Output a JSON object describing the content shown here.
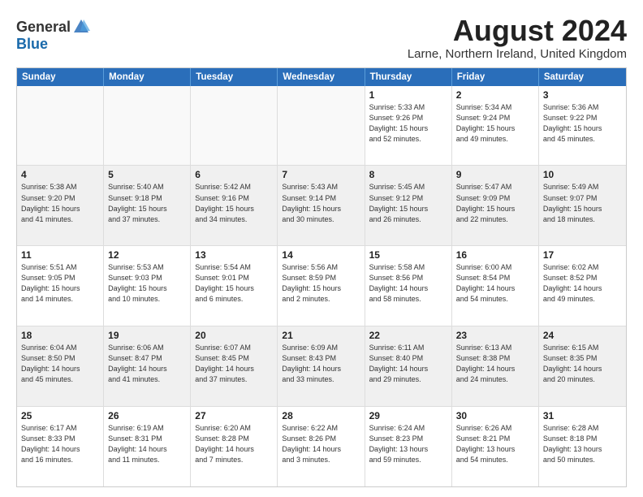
{
  "logo": {
    "general": "General",
    "blue": "Blue"
  },
  "header": {
    "month": "August 2024",
    "location": "Larne, Northern Ireland, United Kingdom"
  },
  "weekdays": [
    "Sunday",
    "Monday",
    "Tuesday",
    "Wednesday",
    "Thursday",
    "Friday",
    "Saturday"
  ],
  "rows": [
    [
      {
        "day": "",
        "info": ""
      },
      {
        "day": "",
        "info": ""
      },
      {
        "day": "",
        "info": ""
      },
      {
        "day": "",
        "info": ""
      },
      {
        "day": "1",
        "info": "Sunrise: 5:33 AM\nSunset: 9:26 PM\nDaylight: 15 hours\nand 52 minutes."
      },
      {
        "day": "2",
        "info": "Sunrise: 5:34 AM\nSunset: 9:24 PM\nDaylight: 15 hours\nand 49 minutes."
      },
      {
        "day": "3",
        "info": "Sunrise: 5:36 AM\nSunset: 9:22 PM\nDaylight: 15 hours\nand 45 minutes."
      }
    ],
    [
      {
        "day": "4",
        "info": "Sunrise: 5:38 AM\nSunset: 9:20 PM\nDaylight: 15 hours\nand 41 minutes."
      },
      {
        "day": "5",
        "info": "Sunrise: 5:40 AM\nSunset: 9:18 PM\nDaylight: 15 hours\nand 37 minutes."
      },
      {
        "day": "6",
        "info": "Sunrise: 5:42 AM\nSunset: 9:16 PM\nDaylight: 15 hours\nand 34 minutes."
      },
      {
        "day": "7",
        "info": "Sunrise: 5:43 AM\nSunset: 9:14 PM\nDaylight: 15 hours\nand 30 minutes."
      },
      {
        "day": "8",
        "info": "Sunrise: 5:45 AM\nSunset: 9:12 PM\nDaylight: 15 hours\nand 26 minutes."
      },
      {
        "day": "9",
        "info": "Sunrise: 5:47 AM\nSunset: 9:09 PM\nDaylight: 15 hours\nand 22 minutes."
      },
      {
        "day": "10",
        "info": "Sunrise: 5:49 AM\nSunset: 9:07 PM\nDaylight: 15 hours\nand 18 minutes."
      }
    ],
    [
      {
        "day": "11",
        "info": "Sunrise: 5:51 AM\nSunset: 9:05 PM\nDaylight: 15 hours\nand 14 minutes."
      },
      {
        "day": "12",
        "info": "Sunrise: 5:53 AM\nSunset: 9:03 PM\nDaylight: 15 hours\nand 10 minutes."
      },
      {
        "day": "13",
        "info": "Sunrise: 5:54 AM\nSunset: 9:01 PM\nDaylight: 15 hours\nand 6 minutes."
      },
      {
        "day": "14",
        "info": "Sunrise: 5:56 AM\nSunset: 8:59 PM\nDaylight: 15 hours\nand 2 minutes."
      },
      {
        "day": "15",
        "info": "Sunrise: 5:58 AM\nSunset: 8:56 PM\nDaylight: 14 hours\nand 58 minutes."
      },
      {
        "day": "16",
        "info": "Sunrise: 6:00 AM\nSunset: 8:54 PM\nDaylight: 14 hours\nand 54 minutes."
      },
      {
        "day": "17",
        "info": "Sunrise: 6:02 AM\nSunset: 8:52 PM\nDaylight: 14 hours\nand 49 minutes."
      }
    ],
    [
      {
        "day": "18",
        "info": "Sunrise: 6:04 AM\nSunset: 8:50 PM\nDaylight: 14 hours\nand 45 minutes."
      },
      {
        "day": "19",
        "info": "Sunrise: 6:06 AM\nSunset: 8:47 PM\nDaylight: 14 hours\nand 41 minutes."
      },
      {
        "day": "20",
        "info": "Sunrise: 6:07 AM\nSunset: 8:45 PM\nDaylight: 14 hours\nand 37 minutes."
      },
      {
        "day": "21",
        "info": "Sunrise: 6:09 AM\nSunset: 8:43 PM\nDaylight: 14 hours\nand 33 minutes."
      },
      {
        "day": "22",
        "info": "Sunrise: 6:11 AM\nSunset: 8:40 PM\nDaylight: 14 hours\nand 29 minutes."
      },
      {
        "day": "23",
        "info": "Sunrise: 6:13 AM\nSunset: 8:38 PM\nDaylight: 14 hours\nand 24 minutes."
      },
      {
        "day": "24",
        "info": "Sunrise: 6:15 AM\nSunset: 8:35 PM\nDaylight: 14 hours\nand 20 minutes."
      }
    ],
    [
      {
        "day": "25",
        "info": "Sunrise: 6:17 AM\nSunset: 8:33 PM\nDaylight: 14 hours\nand 16 minutes."
      },
      {
        "day": "26",
        "info": "Sunrise: 6:19 AM\nSunset: 8:31 PM\nDaylight: 14 hours\nand 11 minutes."
      },
      {
        "day": "27",
        "info": "Sunrise: 6:20 AM\nSunset: 8:28 PM\nDaylight: 14 hours\nand 7 minutes."
      },
      {
        "day": "28",
        "info": "Sunrise: 6:22 AM\nSunset: 8:26 PM\nDaylight: 14 hours\nand 3 minutes."
      },
      {
        "day": "29",
        "info": "Sunrise: 6:24 AM\nSunset: 8:23 PM\nDaylight: 13 hours\nand 59 minutes."
      },
      {
        "day": "30",
        "info": "Sunrise: 6:26 AM\nSunset: 8:21 PM\nDaylight: 13 hours\nand 54 minutes."
      },
      {
        "day": "31",
        "info": "Sunrise: 6:28 AM\nSunset: 8:18 PM\nDaylight: 13 hours\nand 50 minutes."
      }
    ]
  ]
}
